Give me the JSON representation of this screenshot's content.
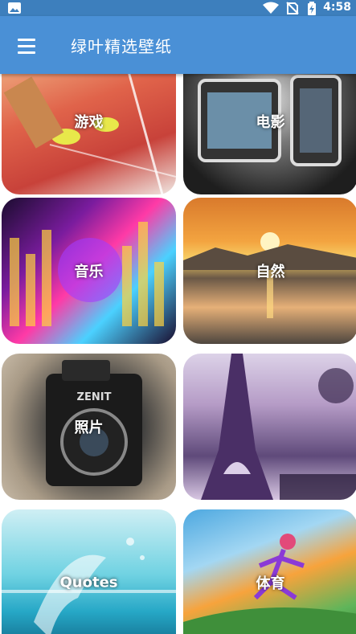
{
  "status": {
    "time": "4:58"
  },
  "appbar": {
    "title": "绿叶精选壁纸"
  },
  "categories": [
    {
      "label": "游戏"
    },
    {
      "label": "电影"
    },
    {
      "label": "音乐"
    },
    {
      "label": "自然"
    },
    {
      "label": "照片"
    },
    {
      "label": ""
    },
    {
      "label": "Quotes"
    },
    {
      "label": "体育"
    }
  ],
  "colors": {
    "appbar": "#4a90d6",
    "statusbar": "#3d7fbd"
  }
}
